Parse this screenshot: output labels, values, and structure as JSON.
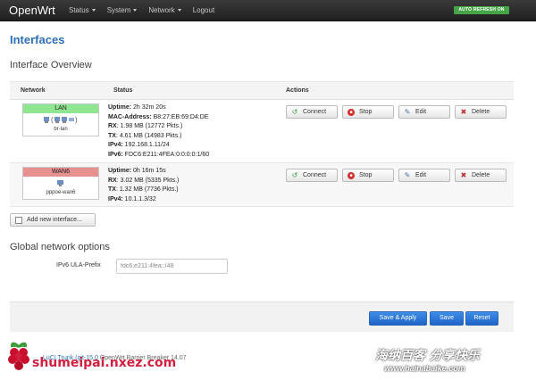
{
  "app": {
    "brand": "OpenWrt",
    "nav": [
      "Status",
      "System",
      "Network",
      "Logout"
    ],
    "auto_refresh": "AUTO REFRESH ON"
  },
  "page": {
    "title": "Interfaces",
    "overview_title": "Interface Overview"
  },
  "table": {
    "headers": {
      "network": "Network",
      "status": "Status",
      "actions": "Actions"
    },
    "rows": [
      {
        "name": "LAN",
        "color": "#90e690",
        "icons": "🖧 (🖧 🖧 🖧)",
        "device": "br-lan",
        "status": [
          {
            "label": "Uptime:",
            "value": " 2h 32m 20s"
          },
          {
            "label": "MAC-Address:",
            "value": " B8:27:EB:69:D4:DE"
          },
          {
            "label": "RX",
            "value": ": 1.98 MB (12772 Pkts.)"
          },
          {
            "label": "TX",
            "value": ": 4.61 MB (14983 Pkts.)"
          },
          {
            "label": "IPv4:",
            "value": " 192.168.1.11/24"
          },
          {
            "label": "IPv6:",
            "value": " FDC6:E211:4FEA:0:0:0:0:1/60"
          }
        ]
      },
      {
        "name": "WAN6",
        "color": "#e69090",
        "icons": "🖧",
        "device": "pppoe-wan6",
        "status": [
          {
            "label": "Uptime:",
            "value": " 0h 16m 15s"
          },
          {
            "label": "RX",
            "value": ": 3.02 MB (5335 Pkts.)"
          },
          {
            "label": "TX",
            "value": ": 1.32 MB (7736 Pkts.)"
          },
          {
            "label": "IPv4:",
            "value": " 10.1.1.3/32"
          }
        ]
      }
    ],
    "buttons": {
      "connect": "Connect",
      "stop": "Stop",
      "edit": "Edit",
      "delete": "Delete"
    }
  },
  "add_interface": "Add new interface...",
  "global": {
    "title": "Global network options",
    "ula_label": "IPv6 ULA-Prefix",
    "ula_value": "fdc6:e211:4fea::/48"
  },
  "actions": {
    "save_apply": "Save & Apply",
    "save": "Save",
    "reset": "Reset"
  },
  "footer": {
    "link": "LuCI Trunk (git-15.0",
    "text": "OpenWrt Barrier Breaker 14.07"
  },
  "watermarks": {
    "left": "shumeipai.nxez.com",
    "right_top": "海纳百客 分享快乐",
    "right_bottom": "www.hainabaike.com"
  }
}
